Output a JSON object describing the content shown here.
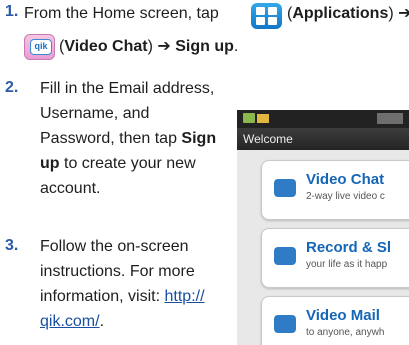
{
  "steps": [
    {
      "number": "1.",
      "line1_a": "From the Home screen, tap",
      "line1_b": "(",
      "line1_bold": "Applications",
      "line1_c": ") ➔",
      "line2_a": "(",
      "line2_bold1": "Video Chat",
      "line2_b": ") ➔ ",
      "line2_bold2": "Sign up",
      "line2_c": "."
    },
    {
      "number": "2.",
      "lines": [
        "Fill in the Email address,",
        "Username, and",
        "Password, then tap",
        "up",
        "to create your new",
        "account."
      ],
      "bold_sign": "Sign"
    },
    {
      "number": "3.",
      "lines": [
        "Follow the on-screen",
        "instructions. For more",
        "information, visit:"
      ],
      "link_part1": "http://",
      "link_part2": "qik.com/",
      "end": "."
    }
  ],
  "icons": {
    "applications": "apps-grid-icon",
    "video_chat": "qik-icon",
    "qik_label": "qik"
  },
  "phone": {
    "header": "Welcome",
    "cards": [
      {
        "title": "Video Chat",
        "subtitle": "2-way live video c"
      },
      {
        "title": "Record & Sl",
        "subtitle": "your life as it happ"
      },
      {
        "title": "Video Mail",
        "subtitle": "to anyone, anywh"
      }
    ]
  },
  "colors": {
    "step_number": "#2b5aa6",
    "link": "#1a4fa3",
    "card_title": "#1566b6"
  }
}
